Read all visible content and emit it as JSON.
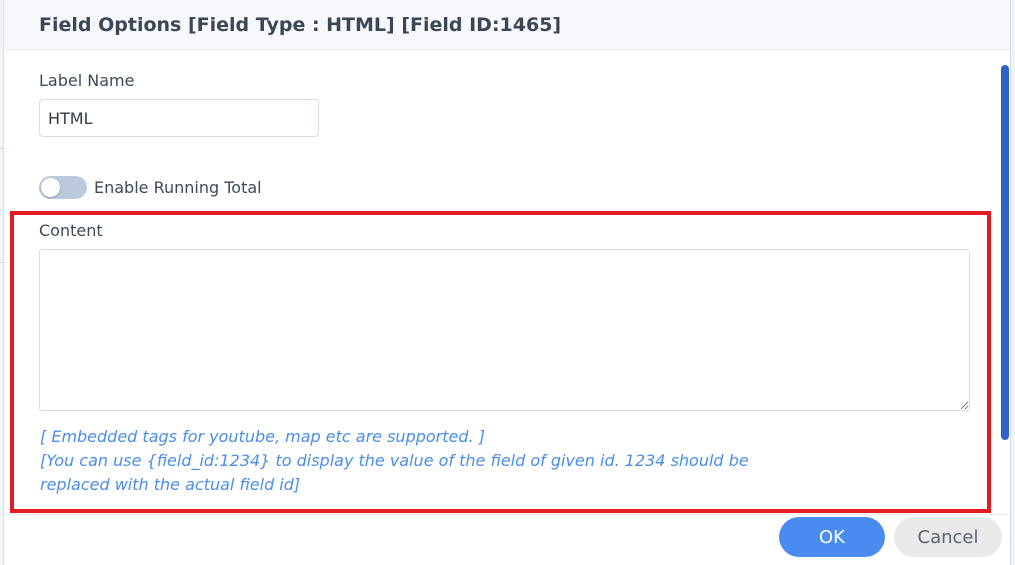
{
  "dialog": {
    "title": "Field Options [Field Type : HTML] [Field ID:1465]"
  },
  "label_name": {
    "label": "Label Name",
    "value": "HTML"
  },
  "running_total": {
    "label": "Enable Running Total",
    "enabled": false
  },
  "content": {
    "label": "Content",
    "value": "",
    "hint_line_1": "[ Embedded tags for youtube, map etc are supported. ]",
    "hint_line_2": "[You can use {field_id:1234} to display the value of the field of given id. 1234 should be",
    "hint_line_3": "replaced with the actual field id]"
  },
  "buttons": {
    "ok": "OK",
    "cancel": "Cancel"
  },
  "colors": {
    "primary": "#4a8bf2",
    "hint_text": "#4a8ee8",
    "highlight": "#e31c24",
    "scrollbar": "#2f62c7"
  }
}
